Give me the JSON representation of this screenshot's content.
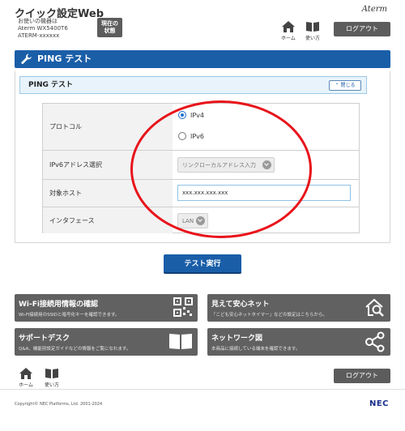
{
  "header": {
    "app_title": "クイック設定Web",
    "device_label_line1": "お使いの機器は",
    "device_label_line2": "Aterm WX5400T6",
    "device_label_line3": "ATERM-xxxxxx",
    "status_button_line1": "現在の",
    "status_button_line2": "状態",
    "brand": "Aterm",
    "home_label": "ホーム",
    "help_label": "使い方",
    "logout_label": "ログアウト"
  },
  "page": {
    "title": "PING テスト",
    "section_title": "PING テスト",
    "close_label": "閉じる"
  },
  "form": {
    "protocol": {
      "label": "プロトコル",
      "options": [
        "IPv4",
        "IPv6"
      ],
      "selected": "IPv4"
    },
    "ipv6_address": {
      "label": "IPv6アドレス選択",
      "value": "リンクローカルアドレス入力"
    },
    "target_host": {
      "label": "対象ホスト",
      "value": "xxx.xxx.xxx.xxx"
    },
    "interface": {
      "label": "インタフェース",
      "value": "LAN"
    },
    "run_button": "テスト実行"
  },
  "tiles": [
    {
      "title": "Wi-Fi接続用情報の確認",
      "desc": "Wi-Fi接続用のSSIDと暗号化キーを確認できます。",
      "icon": "qr-code-icon"
    },
    {
      "title": "見えて安心ネット",
      "desc": "「こども安心ネットタイマー」などの設定はこちらから。",
      "icon": "home-search-icon"
    },
    {
      "title": "サポートデスク",
      "desc": "Q&A、機能別設定ガイドなどの情報をご覧になれます。",
      "icon": "book-icon"
    },
    {
      "title": "ネットワーク図",
      "desc": "本商品に接続している端末を確認できます。",
      "icon": "network-icon"
    }
  ],
  "footer": {
    "home_label": "ホーム",
    "help_label": "使い方",
    "logout_label": "ログアウト",
    "copyright": "Copyright© NEC Platforms, Ltd. 2001-2024",
    "nec_logo": "NEC"
  },
  "colors": {
    "primary": "#1a5ea8",
    "tile": "#616161",
    "annotation": "#e8141b"
  }
}
